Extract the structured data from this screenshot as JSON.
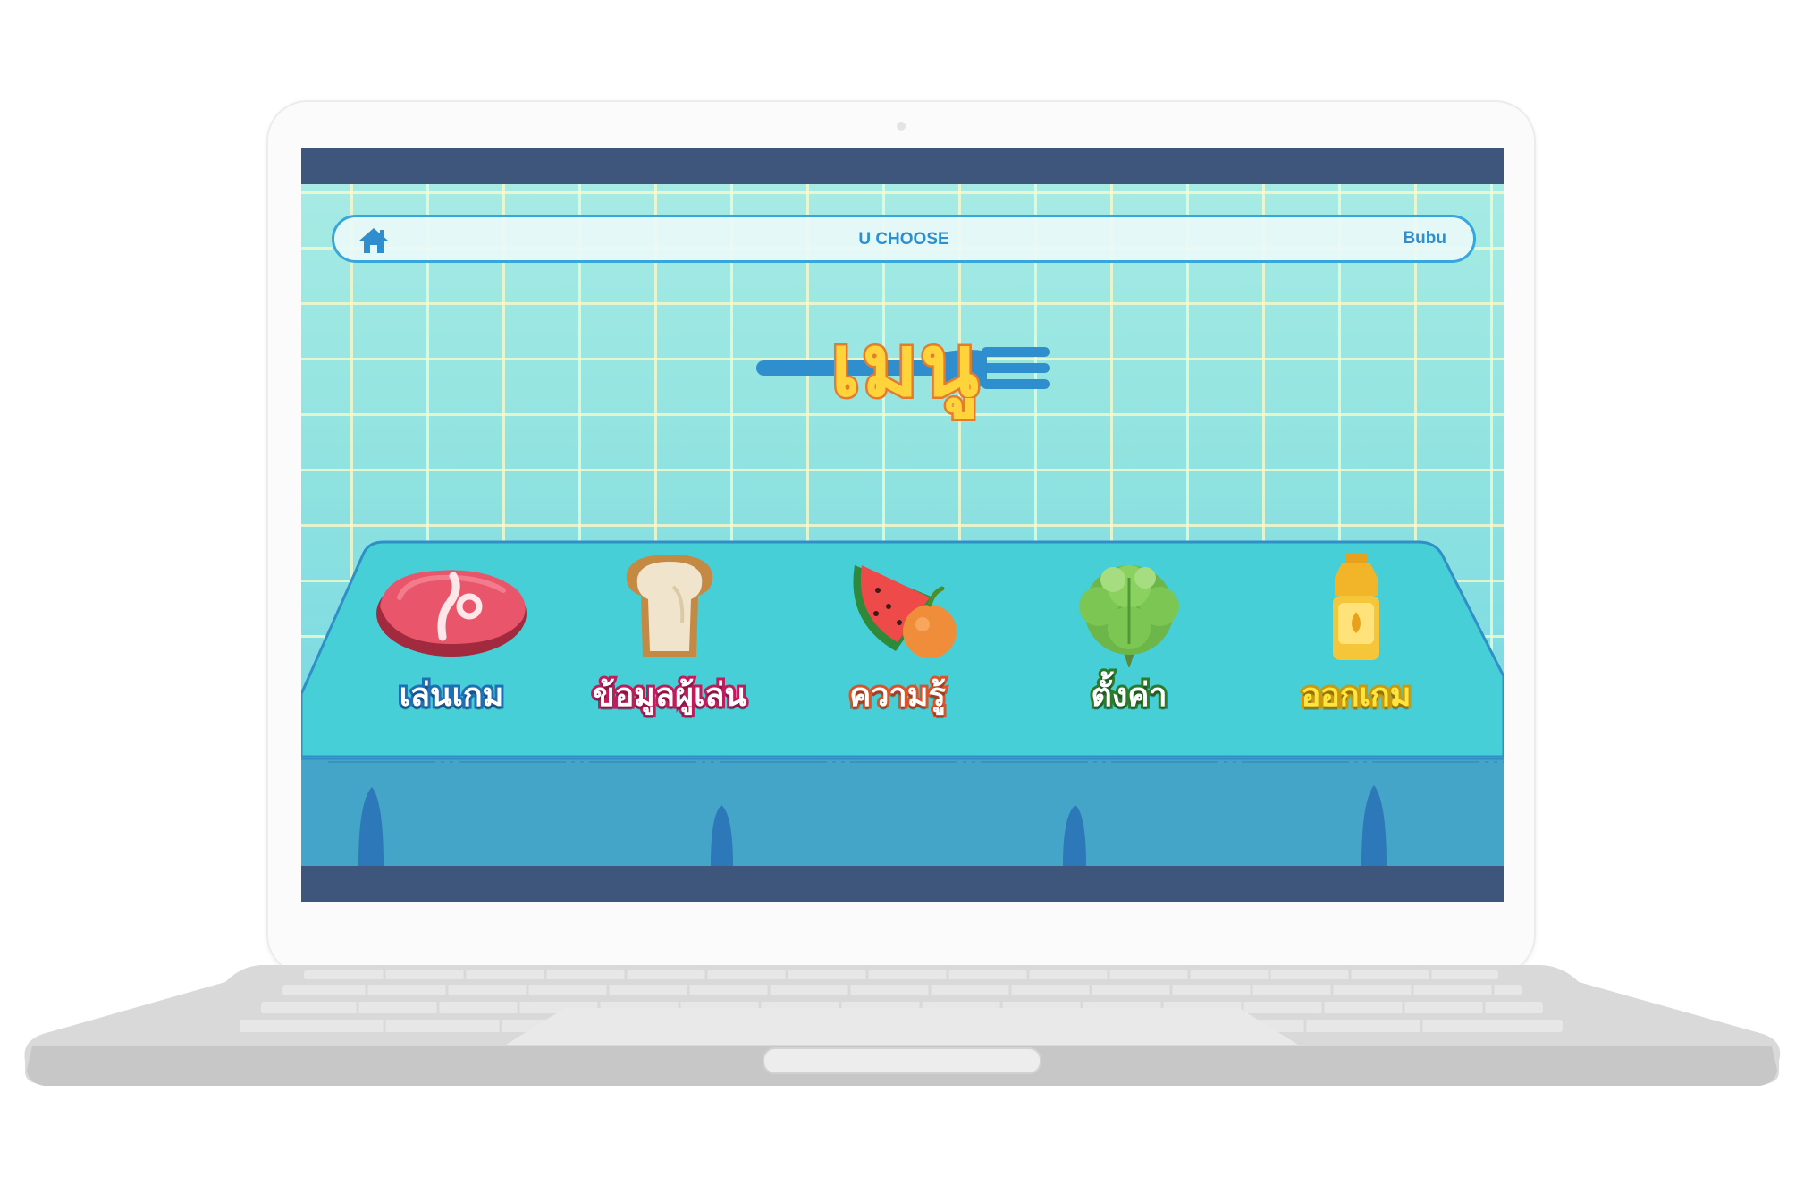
{
  "app": {
    "title": "U CHOOSE",
    "username": "Bubu"
  },
  "menu": {
    "heading": "เมนู",
    "items": [
      {
        "label": "เล่นเกม",
        "icon": "meat-steak-icon",
        "stroke": "#1f6fb5"
      },
      {
        "label": "ข้อมูลผู้เล่น",
        "icon": "bread-slice-icon",
        "stroke": "#c01c5c"
      },
      {
        "label": "ความรู้",
        "icon": "watermelon-orange-icon",
        "stroke": "#d8542a"
      },
      {
        "label": "ตั้งค่า",
        "icon": "lettuce-icon",
        "stroke": "#2b7a2e"
      },
      {
        "label": "ออกเกม",
        "icon": "oil-bottle-icon",
        "stroke": "#c79a10",
        "fill": "#ffe53d"
      }
    ]
  },
  "colors": {
    "screen_frame": "#3f567c",
    "accent": "#36a6dd",
    "heading_fill": "#ffd43a",
    "heading_stroke": "#e57b2c",
    "table_top": "#46cfd7",
    "table_front": "#44a5c8"
  }
}
